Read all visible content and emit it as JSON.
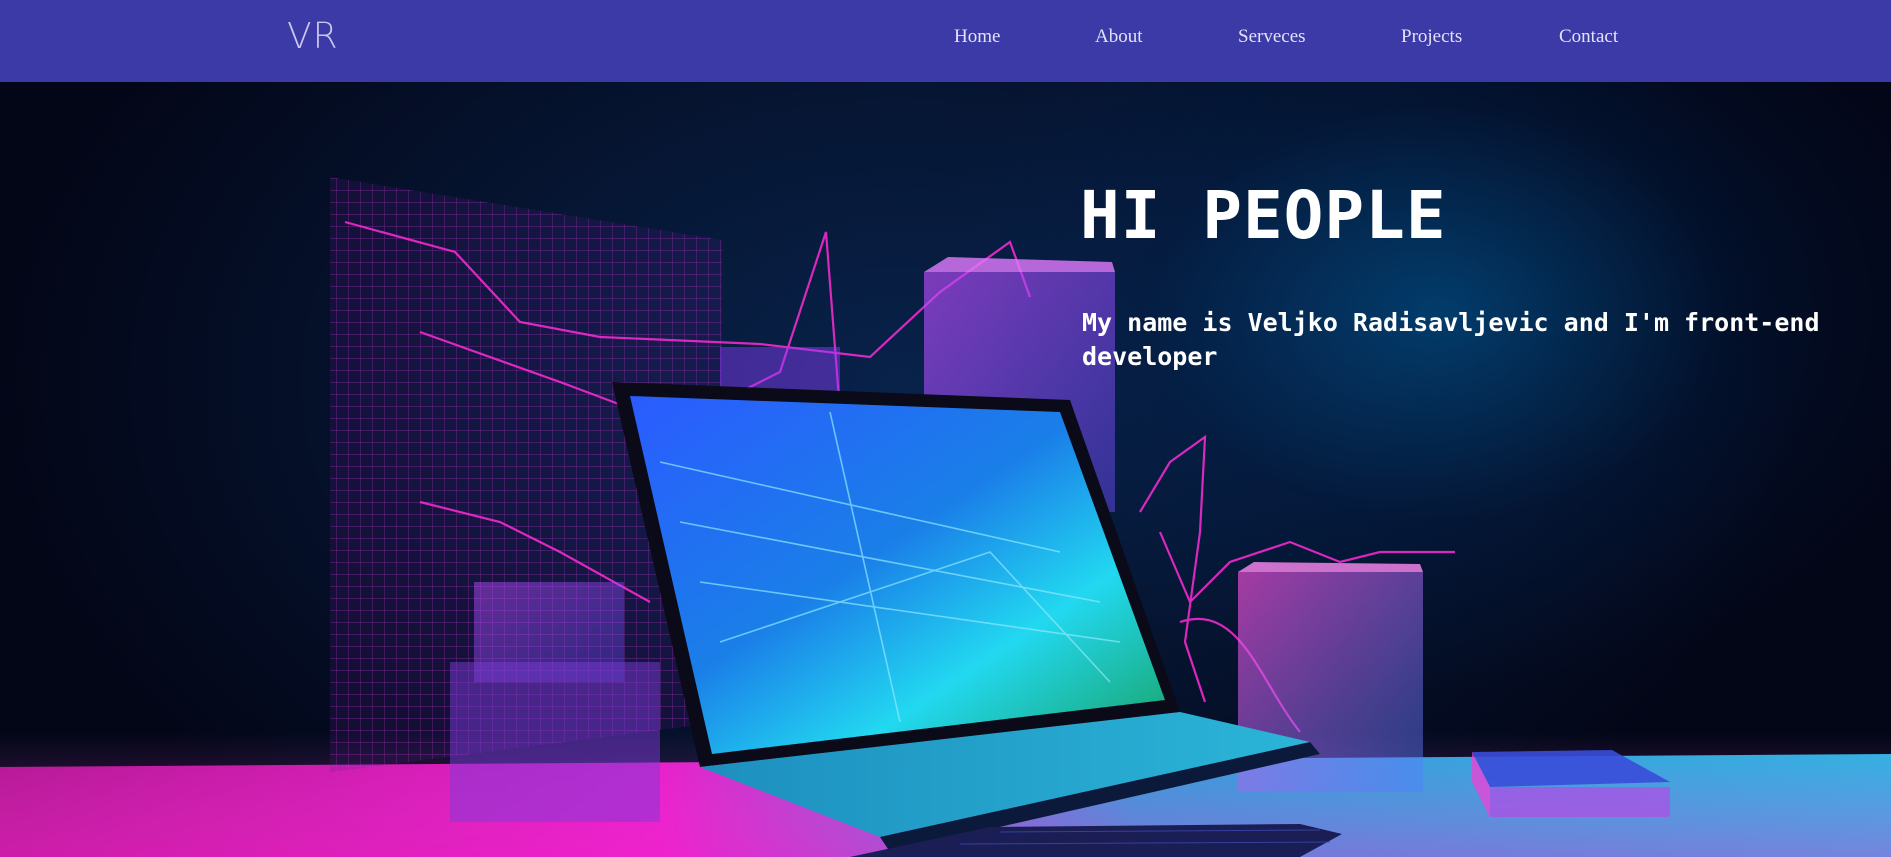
{
  "navbar": {
    "logo": "VR",
    "links": [
      {
        "label": "Home"
      },
      {
        "label": "About"
      },
      {
        "label": "Serveces"
      },
      {
        "label": "Projects"
      },
      {
        "label": "Contact"
      }
    ],
    "background_color": "#3b3aa6"
  },
  "hero": {
    "title": "HI PEOPLE",
    "subtitle": "My name is Veljko Radisavljevic and I'm front-end developer",
    "accent_colors": [
      "#ff2bd6",
      "#8a3cff",
      "#00c8ff"
    ]
  }
}
